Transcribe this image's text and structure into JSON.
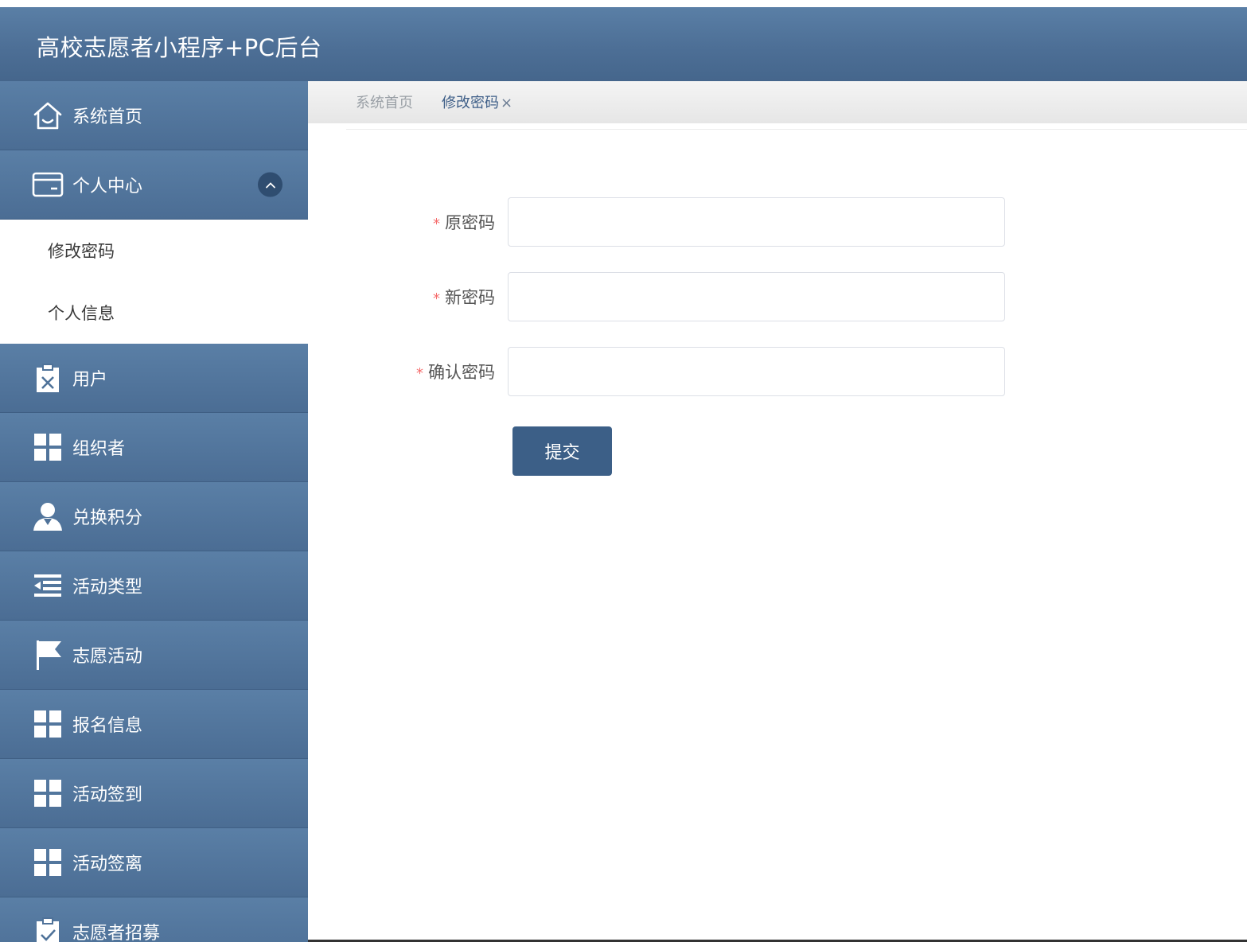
{
  "header": {
    "title": "高校志愿者小程序+PC后台"
  },
  "sidebar": {
    "items": [
      {
        "label": "系统首页",
        "icon": "home-icon"
      },
      {
        "label": "个人中心",
        "icon": "wallet-icon",
        "expanded": true,
        "children": [
          {
            "label": "修改密码"
          },
          {
            "label": "个人信息"
          }
        ]
      },
      {
        "label": "用户",
        "icon": "clipboard-x-icon"
      },
      {
        "label": "组织者",
        "icon": "grid-icon"
      },
      {
        "label": "兑换积分",
        "icon": "user-icon"
      },
      {
        "label": "活动类型",
        "icon": "list-indent-icon"
      },
      {
        "label": "志愿活动",
        "icon": "flag-icon"
      },
      {
        "label": "报名信息",
        "icon": "grid-icon"
      },
      {
        "label": "活动签到",
        "icon": "grid-icon"
      },
      {
        "label": "活动签离",
        "icon": "grid-icon"
      },
      {
        "label": "志愿者招募",
        "icon": "clipboard-check-icon"
      }
    ]
  },
  "tabs": [
    {
      "label": "系统首页",
      "active": false
    },
    {
      "label": "修改密码",
      "active": true,
      "closable": true,
      "close_glyph": "×"
    }
  ],
  "form": {
    "required_mark": "*",
    "fields": [
      {
        "label": "原密码",
        "value": "",
        "placeholder": ""
      },
      {
        "label": "新密码",
        "value": "",
        "placeholder": ""
      },
      {
        "label": "确认密码",
        "value": "",
        "placeholder": ""
      }
    ],
    "submit_label": "提交"
  },
  "colors": {
    "header_bg": "#4d6f96",
    "sidebar_bg": "#4b6d94",
    "submit_bg": "#3c5f87",
    "required": "#f56c6c",
    "active_tab": "#3f5f88"
  }
}
